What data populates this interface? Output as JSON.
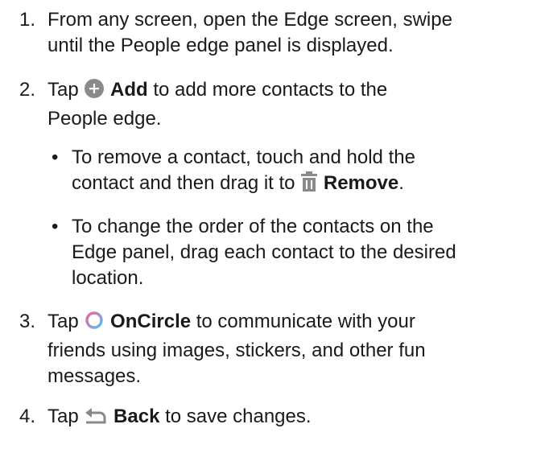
{
  "steps": [
    {
      "number": "1.",
      "lines": [
        "From any screen, open the Edge screen, swipe",
        "until the People edge panel is displayed."
      ]
    },
    {
      "number": "2.",
      "line1_before": "Tap",
      "line1_bold": "Add",
      "line1_after": "to add more contacts to the",
      "line2": "People edge.",
      "icon": "plus-circle-icon"
    },
    {
      "number": "3.",
      "line1_before": "Tap",
      "line1_bold": "OnCircle",
      "line1_after": "to communicate with your",
      "line2": "friends using images, stickers, and other fun",
      "line3": "messages.",
      "icon": "oncircle-icon"
    },
    {
      "number": "4.",
      "line1_before": "Tap",
      "line1_bold": "Back",
      "line1_after": "to save changes.",
      "icon": "back-arrow-icon"
    }
  ],
  "bullets": [
    {
      "marker": "•",
      "line1": "To remove a contact, touch and hold the",
      "line2_before": "contact and then drag it to",
      "line2_bold": "Remove",
      "line2_after": ".",
      "icon": "trash-icon"
    },
    {
      "marker": "•",
      "lines": [
        "To change the order of the contacts on the",
        "Edge panel, drag each contact to the desired",
        "location."
      ]
    }
  ],
  "colors": {
    "text": "#1a1a1a",
    "icon_gray": "#8a8a8a",
    "oncircle_gradient_start": "#f06292",
    "oncircle_gradient_end": "#4fc3f7"
  }
}
